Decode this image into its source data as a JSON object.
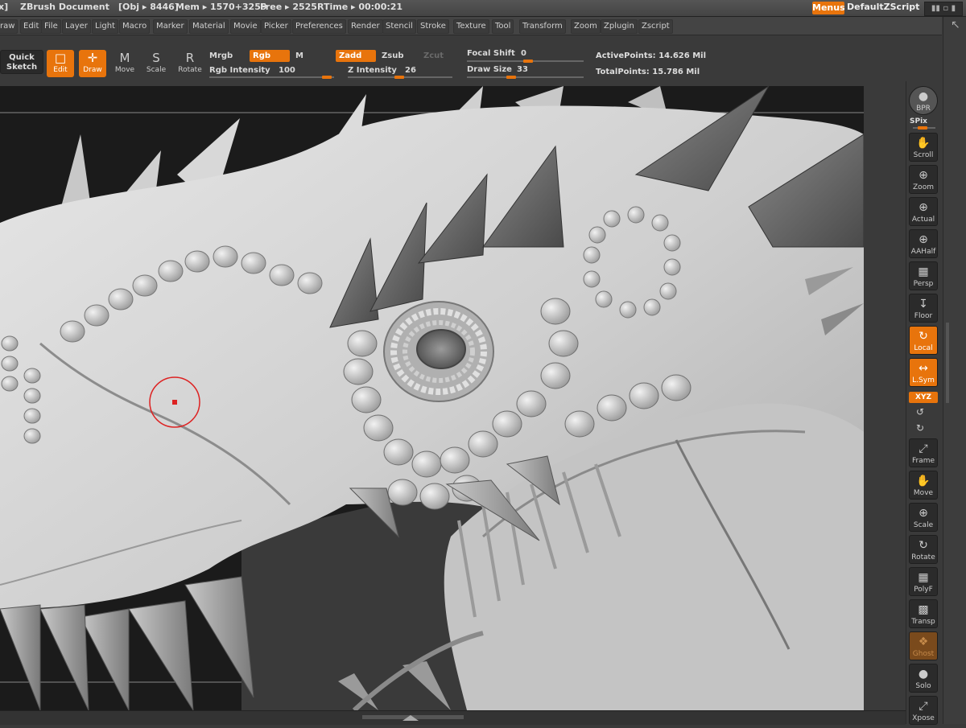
{
  "titlebar": {
    "bracket": "x]",
    "doc": "ZBrush Document",
    "obj": "[Obj ▸ 8446]",
    "mem": "Mem ▸ 1570+3259",
    "free": "Free ▸ 2525",
    "rtime": "RTime ▸ 00:00:21",
    "menus": "Menus",
    "script": "DefaultZScript"
  },
  "menubar": [
    "raw",
    "Edit",
    "File",
    "Layer",
    "Light",
    "Macro",
    "Marker",
    "Material",
    "Movie",
    "Picker",
    "Preferences",
    "Render",
    "Stencil",
    "Stroke",
    "Texture",
    "Tool",
    "Transform",
    "Zoom",
    "Zplugin",
    "Zscript"
  ],
  "toolbar": {
    "quick": "Quick",
    "sketch": "Sketch",
    "edit": "Edit",
    "draw": "Draw",
    "move": "Move",
    "scale": "Scale",
    "rotate": "Rotate",
    "mrgb": "Mrgb",
    "rgb": "Rgb",
    "m": "M",
    "zadd": "Zadd",
    "zsub": "Zsub",
    "zcut": "Zcut",
    "rgb_intensity_label": "Rgb Intensity",
    "rgb_intensity": "100",
    "z_intensity_label": "Z Intensity",
    "z_intensity": "26",
    "focal_shift_label": "Focal Shift",
    "focal_shift": "0",
    "draw_size_label": "Draw Size",
    "draw_size": "33",
    "active_points": "ActivePoints: 14.626  Mil",
    "total_points": "TotalPoints: 15.786  Mil"
  },
  "sidebar": {
    "bpr": "BPR",
    "spix": "SPix",
    "buttons": [
      "Scroll",
      "Zoom",
      "Actual",
      "AAHalf",
      "Persp",
      "Floor",
      "Local",
      "L.Sym",
      "Frame",
      "Move",
      "Scale",
      "Rotate",
      "PolyF",
      "Transp",
      "Ghost",
      "Solo",
      "Xpose"
    ],
    "xyz": "XYZ"
  },
  "colors": {
    "accent": "#e8740c",
    "panel": "#3a3a3a",
    "viewport": "#1c1c1c"
  }
}
